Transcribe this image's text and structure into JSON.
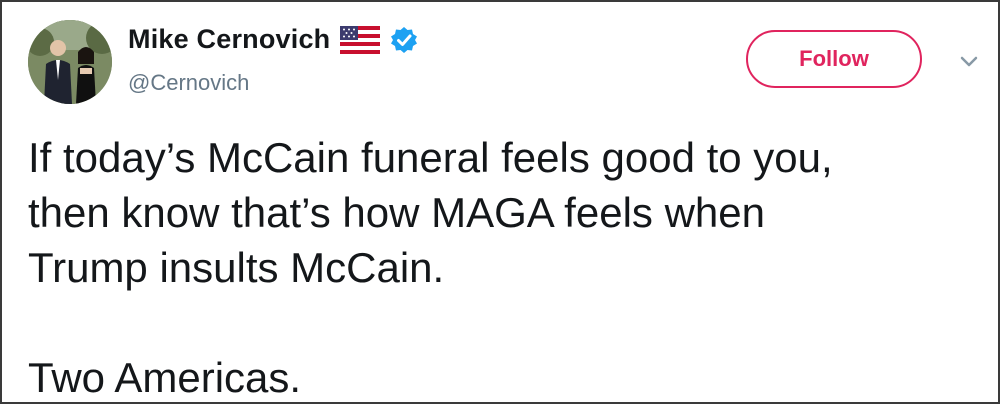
{
  "tweet": {
    "author": {
      "display_name": "Mike Cernovich",
      "handle": "@Cernovich",
      "avatar_icon": "profile-photo",
      "flag_icon": "us-flag-icon",
      "verified_icon": "verified-badge-icon"
    },
    "follow_label": "Follow",
    "menu_icon": "chevron-down-icon",
    "text_lines": [
      "If today’s McCain funeral feels good to you,",
      "then know that’s how MAGA feels when",
      "Trump insults McCain.",
      "Two Americas."
    ]
  },
  "colors": {
    "accent": "#e0245e",
    "verified": "#1da1f2",
    "text": "#14171a",
    "muted": "#657786"
  }
}
